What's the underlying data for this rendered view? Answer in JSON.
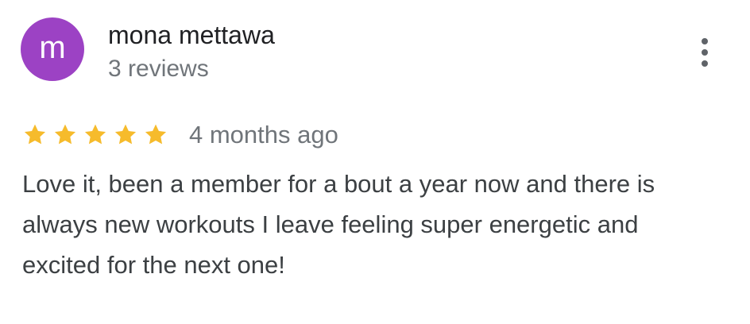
{
  "reviewer": {
    "initial": "m",
    "name": "mona mettawa",
    "review_count": "3 reviews",
    "avatar_color": "#9c42c4"
  },
  "menu": {
    "icon": "more-vert-icon"
  },
  "review": {
    "rating": 5,
    "rating_max": 5,
    "star_icon": "star-icon",
    "star_color": "#f6bb2c",
    "date": "4 months ago",
    "text": "Love it, been a member for a bout a year now and there is always new workouts I leave feeling super energetic and excited for the next one!"
  }
}
